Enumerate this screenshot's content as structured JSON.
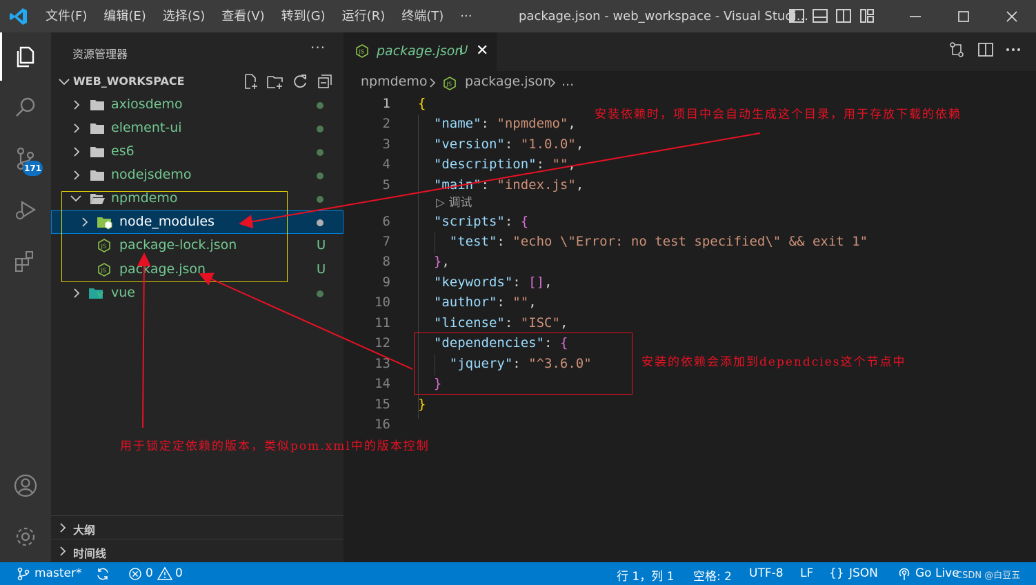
{
  "titlebar": {
    "menu": [
      "文件(F)",
      "编辑(E)",
      "选择(S)",
      "查看(V)",
      "转到(G)",
      "运行(R)",
      "终端(T)",
      "···"
    ],
    "window_title": "package.json - web_workspace - Visual Studi..."
  },
  "activity": {
    "scm_badge": "171"
  },
  "sidebar": {
    "header": "资源管理器",
    "more": "···",
    "workspace": "WEB_WORKSPACE",
    "tree": [
      {
        "label": "axiosdemo",
        "status": "dot"
      },
      {
        "label": "element-ui",
        "status": "dot"
      },
      {
        "label": "es6",
        "status": "dot"
      },
      {
        "label": "nodejsdemo",
        "status": "dot"
      },
      {
        "label": "npmdemo",
        "status": "dot"
      },
      {
        "label": "node_modules",
        "status": "dot"
      },
      {
        "label": "package-lock.json",
        "status": "U"
      },
      {
        "label": "package.json",
        "status": "U"
      },
      {
        "label": "vue",
        "status": "dot"
      }
    ],
    "sections": [
      "大纲",
      "时间线"
    ]
  },
  "editor": {
    "tab": {
      "name": "package.json",
      "status": "U",
      "close": "✕"
    },
    "breadcrumb": [
      "npmdemo",
      "package.json",
      "..."
    ],
    "codelens": "调试",
    "line_numbers": [
      "1",
      "2",
      "3",
      "4",
      "5",
      "6",
      "7",
      "8",
      "9",
      "10",
      "11",
      "12",
      "13",
      "14",
      "15",
      "16"
    ]
  },
  "statusbar": {
    "branch": "master*",
    "errors": "0",
    "warnings": "0",
    "position": "行 1，列 1",
    "spaces": "空格: 2",
    "encoding": "UTF-8",
    "eol": "LF",
    "language": "JSON",
    "golive": "Go Live",
    "watermark": "CSDN @白豆五"
  },
  "annotations": {
    "note_node_modules": "安装依赖时，项目中会自动生成这个目录，用于存放下载的依赖",
    "note_dependencies": "安装的依赖会添加到dependcies这个节点中",
    "note_lock": "用于锁定定依赖的版本，类似pom.xml中的版本控制"
  },
  "colors": {
    "annotation_red": "#e81123",
    "highlight_yellow": "#e5d400",
    "statusbar_blue": "#007acc",
    "untracked_green": "#73c991"
  }
}
